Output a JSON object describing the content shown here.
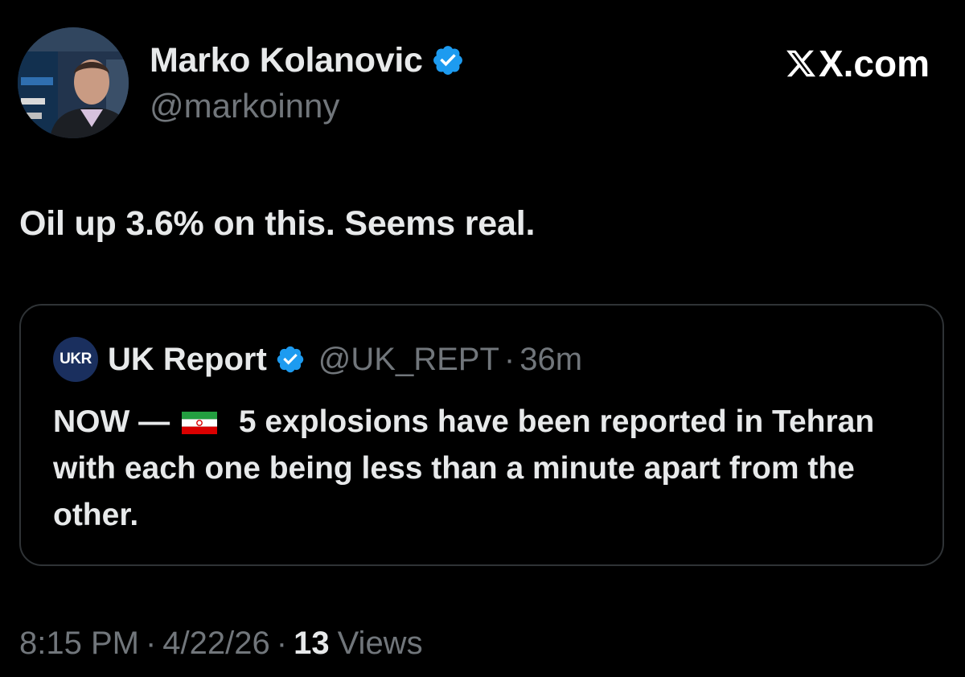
{
  "colors": {
    "background": "#000000",
    "primary_text": "#e7e9ea",
    "secondary_text": "#71767b",
    "verified_blue": "#1d9bf0",
    "card_border": "#2f3336"
  },
  "tweet": {
    "author": {
      "name": "Marko Kolanovic",
      "handle": "@markoinny",
      "verified": true,
      "avatar_icon": "profile-photo"
    },
    "brand_watermark": "X.com",
    "text": "Oil up 3.6% on this. Seems real.",
    "quoted": {
      "avatar_text": "UKR",
      "name": "UK Report",
      "handle": "@UK_REPT",
      "separator": "·",
      "time": "36m",
      "body_prefix": "NOW —",
      "flag_icon": "iran-flag-emoji",
      "body_main": "5 explosions have been reported in Tehran with each one being less than a minute apart from the other."
    },
    "meta": {
      "time": "8:15 PM",
      "separator": "·",
      "date": "4/22/26",
      "views_count": "13",
      "views_label": "Views"
    }
  }
}
